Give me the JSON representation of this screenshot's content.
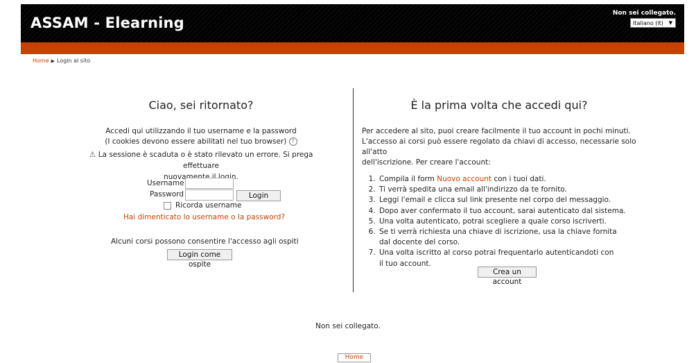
{
  "header": {
    "site_title": "ASSAM - Elearning",
    "login_status": "Non sei collegato.",
    "language": "Italiano (it)"
  },
  "breadcrumb": {
    "home": "Home",
    "current": "Login al sito"
  },
  "login": {
    "heading": "Ciao, sei ritornato?",
    "intro_line1": "Accedi qui utilizzando il tuo username e la password",
    "intro_line2": "(I cookies devono essere abilitati nel tuo browser)",
    "error_line1": "La sessione è scaduta o è stato rilevato un errore. Si prega effettuare",
    "error_line2": "nuovamente il login.",
    "username_label": "Username",
    "username_value": "",
    "password_label": "Password",
    "password_value": "",
    "login_button": "Login",
    "remember_label": "Ricorda username",
    "forgot_link": "Hai dimenticato lo username o la password?",
    "guest_text": "Alcuni corsi possono consentire l'accesso agli ospiti",
    "guest_button": "Login come ospite"
  },
  "signup": {
    "heading": "È la prima volta che accedi qui?",
    "desc_line1": "Per accedere al sito, puoi creare facilmente il tuo account in pochi minuti.",
    "desc_line2": "L'accesso ai corsi può essere regolato da chiavi di accesso, necessarie solo all'atto",
    "desc_line3": "dell'iscrizione. Per creare l'account:",
    "step1_prefix": "Compila il form ",
    "step1_link": "Nuovo account",
    "step1_suffix": " con i tuoi dati.",
    "step2": "Ti verrà spedita una email all'indirizzo da te fornito.",
    "step3": "Leggi l'email e clicca sul link presente nel corpo del messaggio.",
    "step4": "Dopo aver confermato il tuo account, sarai autenticato dal sistema.",
    "step5": "Una volta autenticato, potrai scegliere a quale corso iscriverti.",
    "step6": "Se ti verrà richiesta una chiave di iscrizione, usa la chiave fornita dal docente del corso.",
    "step7": "Una volta iscritto al corso potrai frequentarlo autenticandoti con il tuo account.",
    "create_button": "Crea un account"
  },
  "footer": {
    "login_status": "Non sei collegato.",
    "home_button": "Home"
  },
  "colors": {
    "accent": "#c94000",
    "header_bg": "#000000"
  }
}
